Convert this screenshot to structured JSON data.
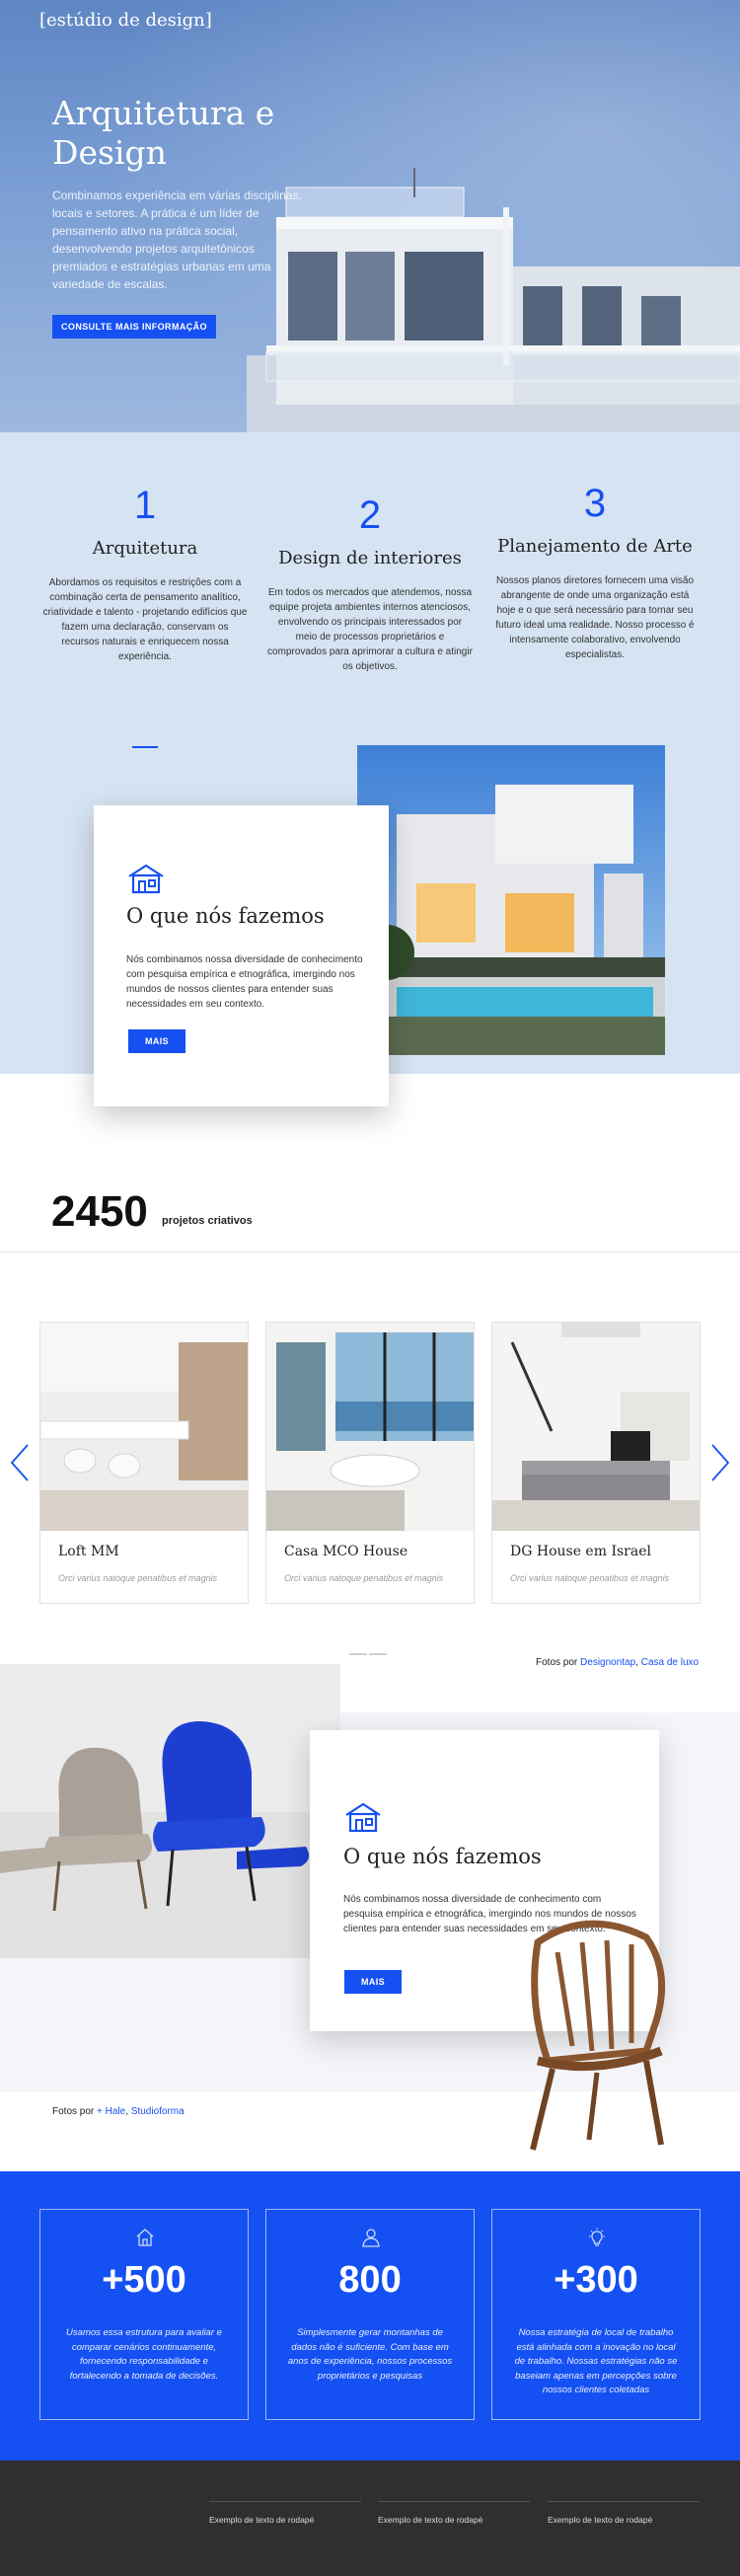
{
  "hero": {
    "brand": "[estúdio de design]",
    "title": "Arquitetura e Design",
    "text": "Combinamos experiência em várias disciplinas, locais e setores. A prática é um líder de pensamento ativo na prática social, desenvolvendo projetos arquitetônicos premiados e estratégias urbanas em uma variedade de escalas.",
    "button": "Consulte mais informação"
  },
  "features": [
    {
      "number": "1",
      "title": "Arquitetura",
      "text": "Abordamos os requisitos e restrições com a combinação certa de pensamento analítico, criatividade e talento - projetando edifícios que fazem uma declaração, conservam os recursos naturais e enriquecem nossa experiência."
    },
    {
      "number": "2",
      "title": "Design de interiores",
      "text": "Em todos os mercados que atendemos, nossa equipe projeta ambientes internos atenciosos, envolvendo os principais interessados por meio de processos proprietários e comprovados para aprimorar a cultura e atingir os objetivos."
    },
    {
      "number": "3",
      "title": "Planejamento de Arte",
      "text": "Nossos planos diretores fornecem uma visão abrangente de onde uma organização está hoje e o que será necessário para tornar seu futuro ideal uma realidade. Nosso processo é intensamente colaborativo, envolvendo especialistas."
    }
  ],
  "what_we_do_1": {
    "title": "O que nós fazemos",
    "text": "Nós combinamos nossa diversidade de conhecimento com pesquisa empírica e etnográfica, imergindo nos mundos de nossos clientes para entender suas necessidades em seu contexto.",
    "button": "MAIS"
  },
  "stats": {
    "number": "2450",
    "label": "projetos criativos"
  },
  "gallery": [
    {
      "title": "Loft MM",
      "subtitle": "Orci varius natoque penatibus et magnis"
    },
    {
      "title": "Casa MCO House",
      "subtitle": "Orci varius natoque penatibus et magnis"
    },
    {
      "title": "DG House em Israel",
      "subtitle": "Orci varius natoque penatibus et magnis"
    }
  ],
  "credits1": {
    "prefix": "Fotos por",
    "link1": "Designontap",
    "sep": ",",
    "link2": "Casa de luxo"
  },
  "what_we_do_2": {
    "title": "O que nós fazemos",
    "text": "Nós combinamos nossa diversidade de conhecimento com pesquisa empírica e etnográfica, imergindo nos mundos de nossos clientes para entender suas necessidades em seu contexto.",
    "button": "MAIS"
  },
  "credits2": {
    "prefix": "Fotos por",
    "link1": "+ Hale",
    "sep": ",",
    "link2": "Studioforma"
  },
  "blue_stats": [
    {
      "icon": "home-icon",
      "value": "+500",
      "text": "Usamos essa estrutura para avaliar e comparar cenários continuamente, fornecendo responsabilidade e fortalecendo a tomada de decisões."
    },
    {
      "icon": "user-icon",
      "value": "800",
      "text": "Simplesmente gerar montanhas de dados não é suficiente. Com base em anos de experiência, nossos processos proprietários e pesquisas"
    },
    {
      "icon": "lightbulb-icon",
      "value": "+300",
      "text": "Nossa estratégia de local de trabalho está alinhada com a inovação no local de trabalho. Nossas estratégias não se baseiam apenas em percepções sobre nossos clientes coletadas"
    }
  ],
  "footer": [
    "Exemplo de texto de rodapé",
    "Exemplo de texto de rodapé",
    "Exemplo de texto de rodapé"
  ],
  "colors": {
    "accent": "#1550f2",
    "features_bg": "#d6e3f2",
    "footer_bg": "#2f2f2f"
  }
}
